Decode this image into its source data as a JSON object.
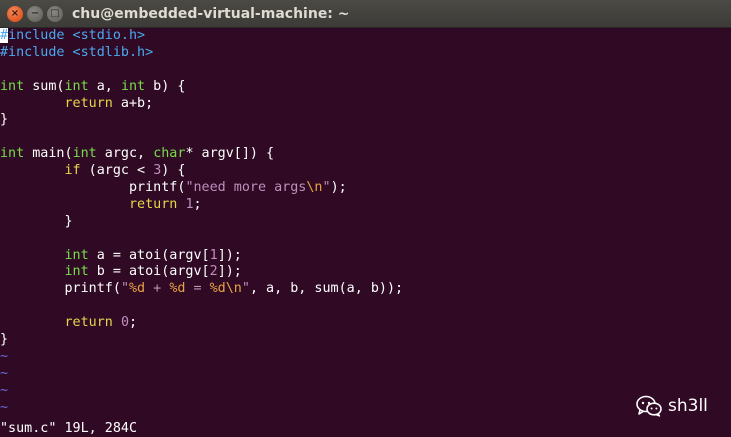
{
  "window": {
    "title": "chu@embedded-virtual-machine: ~",
    "close_glyph": "×",
    "minimize_glyph": "−",
    "maximize_glyph": "□"
  },
  "editor": {
    "file_name": "sum.c",
    "colors": {
      "background": "#300a24",
      "preprocessor": "#4aa8f0",
      "type": "#78dc4a",
      "keyword": "#e8d44d",
      "string": "#bf8fbe",
      "number": "#bf8fbe",
      "special": "#e8a243",
      "tilde": "#6a6ae0"
    },
    "lines": [
      [
        {
          "t": "#",
          "c": "cursor"
        },
        {
          "t": "include <stdio.h>",
          "c": "pp"
        }
      ],
      [
        {
          "t": "#include <stdlib.h>",
          "c": "pp"
        }
      ],
      [],
      [
        {
          "t": "int",
          "c": "ty"
        },
        {
          "t": " sum("
        },
        {
          "t": "int",
          "c": "ty"
        },
        {
          "t": " a, "
        },
        {
          "t": "int",
          "c": "ty"
        },
        {
          "t": " b) {"
        }
      ],
      [
        {
          "t": "        "
        },
        {
          "t": "return",
          "c": "kw"
        },
        {
          "t": " a+b;"
        }
      ],
      [
        {
          "t": "}"
        }
      ],
      [],
      [
        {
          "t": "int",
          "c": "ty"
        },
        {
          "t": " main("
        },
        {
          "t": "int",
          "c": "ty"
        },
        {
          "t": " argc, "
        },
        {
          "t": "char",
          "c": "ty"
        },
        {
          "t": "* argv[]) {"
        }
      ],
      [
        {
          "t": "        "
        },
        {
          "t": "if",
          "c": "kw"
        },
        {
          "t": " (argc < "
        },
        {
          "t": "3",
          "c": "nm"
        },
        {
          "t": ") {"
        }
      ],
      [
        {
          "t": "                printf("
        },
        {
          "t": "\"need more args",
          "c": "st"
        },
        {
          "t": "\\n",
          "c": "sp"
        },
        {
          "t": "\"",
          "c": "st"
        },
        {
          "t": ");"
        }
      ],
      [
        {
          "t": "                "
        },
        {
          "t": "return",
          "c": "kw"
        },
        {
          "t": " "
        },
        {
          "t": "1",
          "c": "nm"
        },
        {
          "t": ";"
        }
      ],
      [
        {
          "t": "        }"
        }
      ],
      [],
      [
        {
          "t": "        "
        },
        {
          "t": "int",
          "c": "ty"
        },
        {
          "t": " a = atoi(argv["
        },
        {
          "t": "1",
          "c": "nm"
        },
        {
          "t": "]);"
        }
      ],
      [
        {
          "t": "        "
        },
        {
          "t": "int",
          "c": "ty"
        },
        {
          "t": " b = atoi(argv["
        },
        {
          "t": "2",
          "c": "nm"
        },
        {
          "t": "]);"
        }
      ],
      [
        {
          "t": "        printf("
        },
        {
          "t": "\"",
          "c": "st"
        },
        {
          "t": "%d",
          "c": "sp"
        },
        {
          "t": " + ",
          "c": "st"
        },
        {
          "t": "%d",
          "c": "sp"
        },
        {
          "t": " = ",
          "c": "st"
        },
        {
          "t": "%d\\n",
          "c": "sp"
        },
        {
          "t": "\"",
          "c": "st"
        },
        {
          "t": ", a, b, sum(a, b));"
        }
      ],
      [],
      [
        {
          "t": "        "
        },
        {
          "t": "return",
          "c": "kw"
        },
        {
          "t": " "
        },
        {
          "t": "0",
          "c": "nm"
        },
        {
          "t": ";"
        }
      ],
      [
        {
          "t": "}"
        }
      ],
      [
        {
          "t": "~",
          "c": "tilde"
        }
      ],
      [
        {
          "t": "~",
          "c": "tilde"
        }
      ],
      [
        {
          "t": "~",
          "c": "tilde"
        }
      ],
      [
        {
          "t": "~",
          "c": "tilde"
        }
      ]
    ],
    "status_line": "\"sum.c\" 19L, 284C"
  },
  "watermark": {
    "icon": "wechat-icon",
    "text": "sh3ll"
  }
}
